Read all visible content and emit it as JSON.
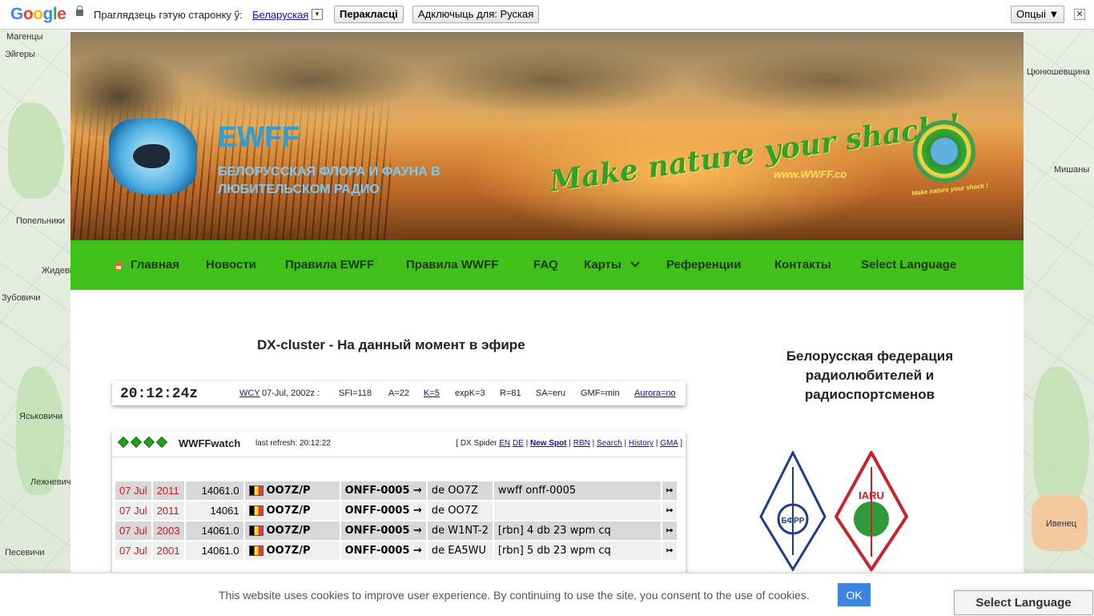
{
  "translate_bar": {
    "logo": [
      "G",
      "o",
      "o",
      "g",
      "l",
      "e"
    ],
    "prompt": "Праглядзець гэтую старонку ў:",
    "language": "Беларуская",
    "translate_button": "Перакласці",
    "disable_button": "Адключыць для: Руская",
    "options_button": "Опцыі ▼",
    "close": "✕"
  },
  "map_labels": [
    "Магенцы",
    "Эйгеры",
    "Попельники",
    "Жидевичи",
    "Зубовичи",
    "Яськовичи",
    "Лежневичи",
    "Песевичи",
    "Цюнюшевщина",
    "Мишаны",
    "Ивенец"
  ],
  "header": {
    "site_title": "EWFF",
    "site_subtitle": "Белорусская флора и фауна в любительском радио",
    "slogan": "Make nature your shack !",
    "slogan_url": "www.WWFF.co",
    "wwff_logo_text": "Make nature your shack !"
  },
  "nav": {
    "items": [
      "Главная",
      "Новости",
      "Правила EWFF",
      "Правила WWFF",
      "FAQ",
      "Карты",
      "Референции",
      "Контакты",
      "Select Language"
    ]
  },
  "main": {
    "heading": "DX-cluster - На данный момент в эфире",
    "wcy": {
      "time": "20:12:24z",
      "wcy_link": "WCY",
      "date": "07-Jul, 2002z :",
      "sfi": "SFI=118",
      "a": "A=22",
      "k": "K=5",
      "expk": "expK=3",
      "r": "R=81",
      "sa": "SA=eru",
      "gmf": "GMF=min",
      "aurora": "Aurora=no"
    },
    "watch": {
      "title": "WWFFwatch",
      "refresh_label": "last refresh: 20:12:22",
      "links_prefix": "[ DX Spider",
      "link_en": "EN",
      "link_de": "DE",
      "sep": "|",
      "link_newspot": "New Spot",
      "link_rbn": "RBN",
      "link_search": "Search",
      "link_history": "History",
      "link_gma": "GMA",
      "links_suffix": "]",
      "rows": [
        {
          "date": "07 Jul",
          "time": "2011",
          "freq": "14061.0",
          "call": "OO7Z/P",
          "ref": "ONFF-0005 →",
          "spotter": "de OO7Z",
          "comment": "wwff onff-0005",
          "go": "↦"
        },
        {
          "date": "07 Jul",
          "time": "2011",
          "freq": "14061",
          "call": "OO7Z/P",
          "ref": "ONFF-0005 →",
          "spotter": "de OO7Z",
          "comment": "",
          "go": "↦"
        },
        {
          "date": "07 Jul",
          "time": "2003",
          "freq": "14061.0",
          "call": "OO7Z/P",
          "ref": "ONFF-0005 →",
          "spotter": "de W1NT-2",
          "comment": "[rbn] 4 db 23 wpm cq",
          "go": "↦"
        },
        {
          "date": "07 Jul",
          "time": "2001",
          "freq": "14061.0",
          "call": "OO7Z/P",
          "ref": "ONFF-0005 →",
          "spotter": "de EA5WU",
          "comment": "[rbn] 5 db 23 wpm cq",
          "go": "↦"
        }
      ]
    }
  },
  "sidebar": {
    "heading": "Белорусская федерация радиолюбителей и радиоспортсменов",
    "bfrr_logo_text": "БФРР",
    "iaru_logo_text": "IARU"
  },
  "cookie": {
    "text": "This website uses cookies to improve user experience. By continuing to use the site, you consent to the use of cookies.",
    "ok": "OK"
  },
  "floating_language": "Select Language",
  "colors": {
    "nav_green": "#3fc01a",
    "link_blue": "#1a0dab",
    "date_red": "#c02020",
    "cookie_ok": "#3f85e0"
  }
}
